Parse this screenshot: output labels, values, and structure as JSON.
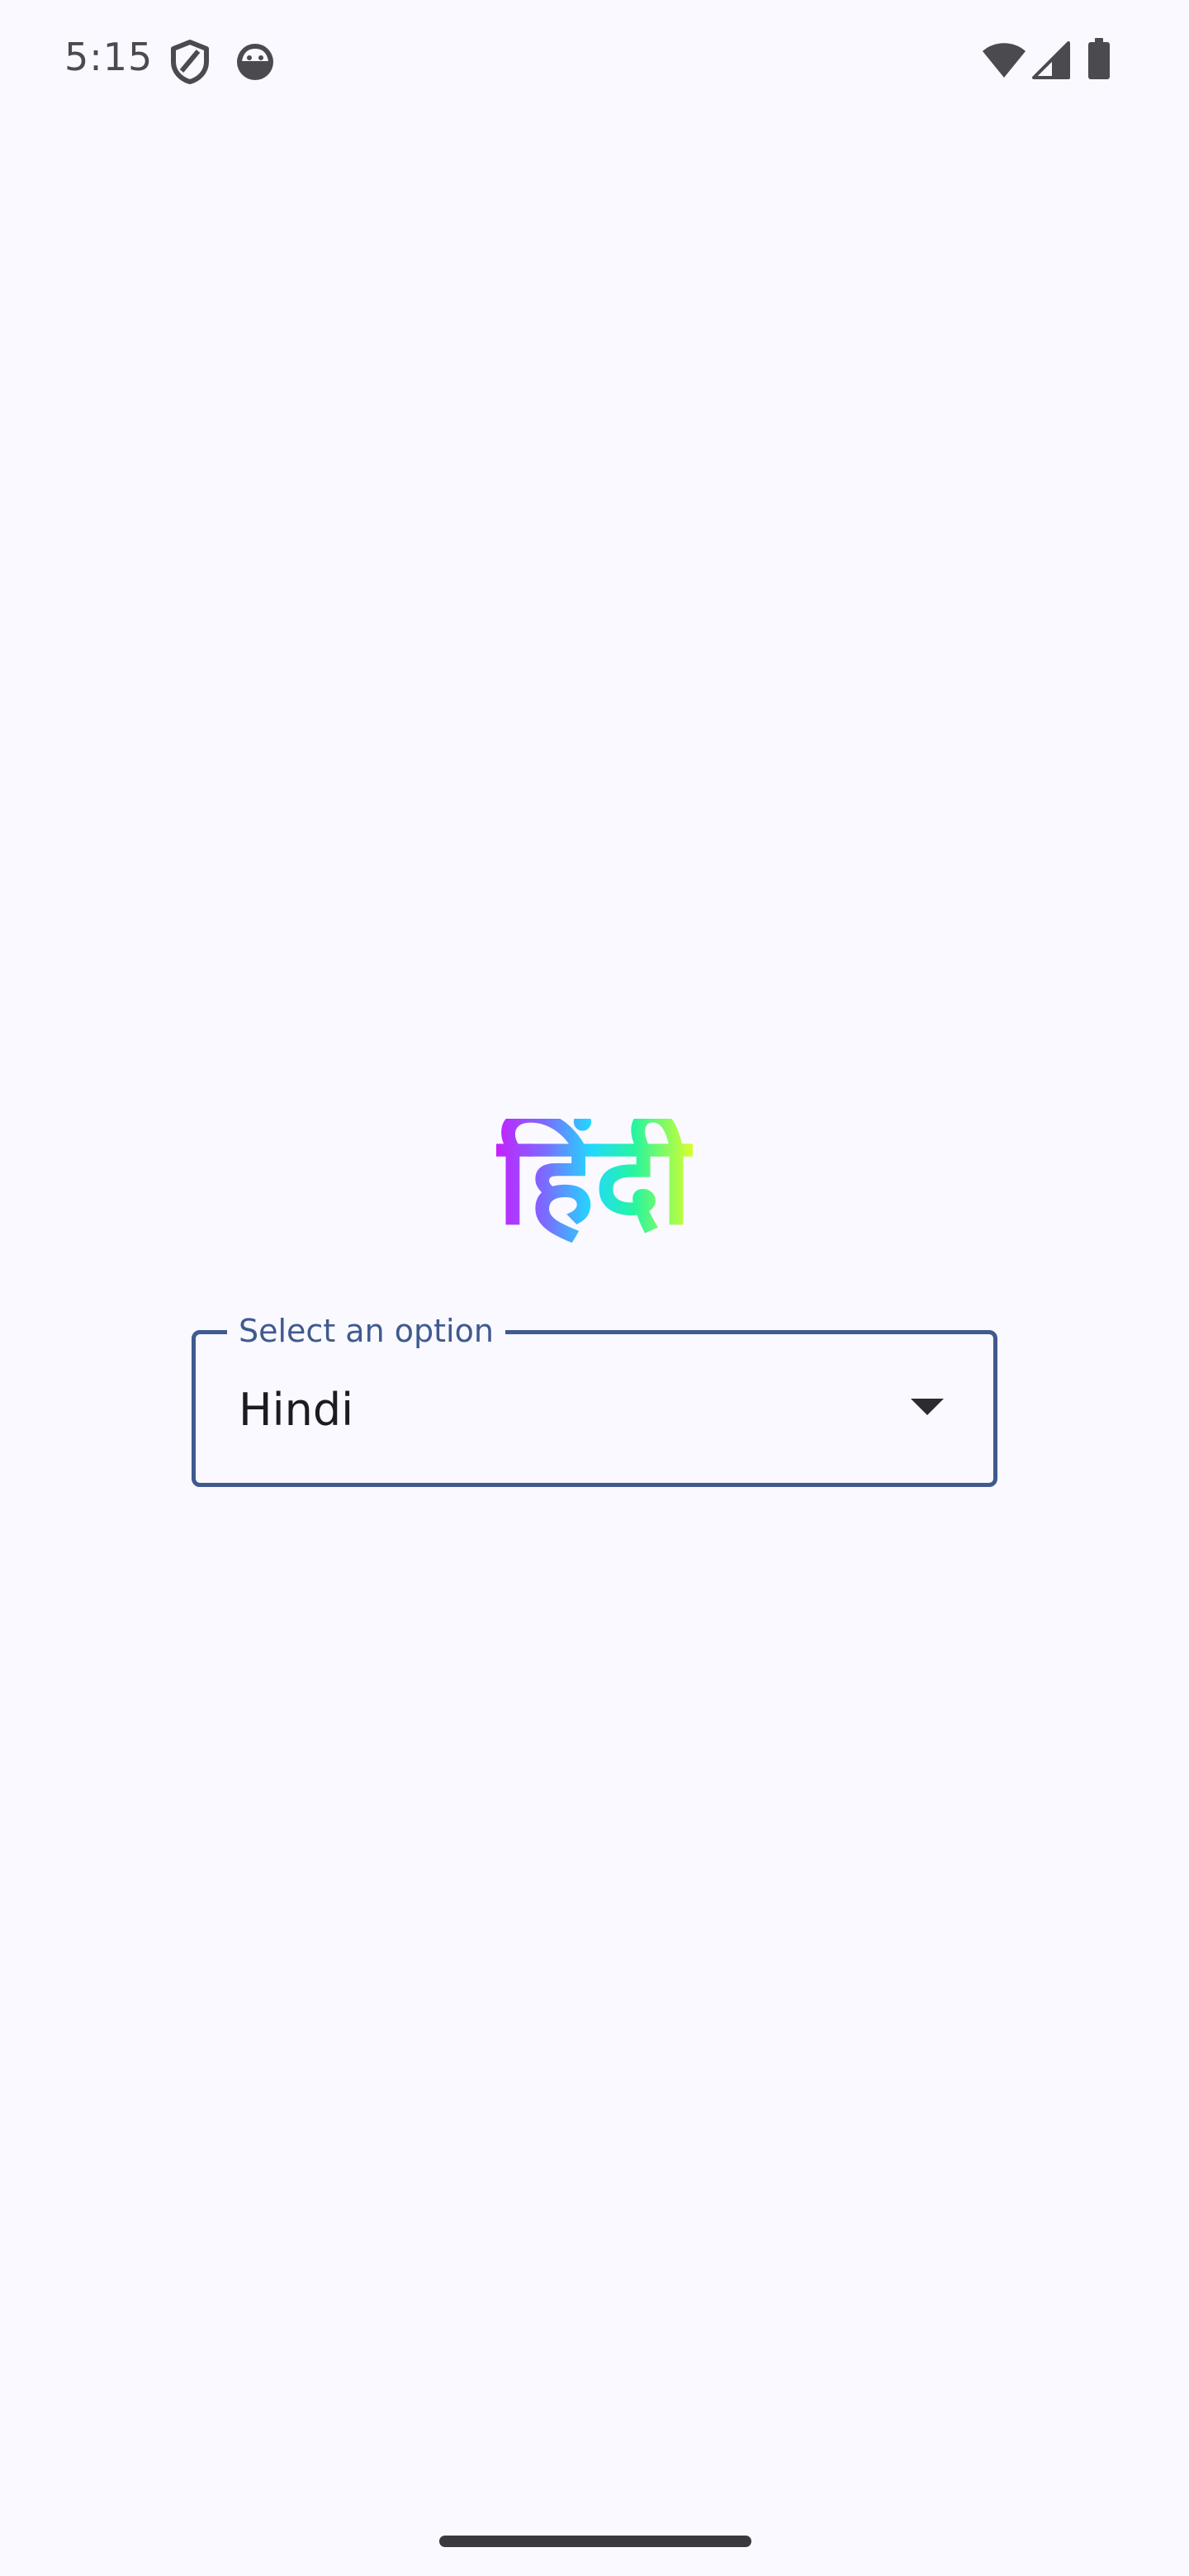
{
  "status_bar": {
    "time": "5:15",
    "icons": [
      "shield-icon",
      "android-face-icon",
      "wifi-icon",
      "cellular-signal-icon",
      "battery-icon"
    ]
  },
  "main": {
    "title": "हिंदी",
    "dropdown": {
      "label": "Select an option",
      "value": "Hindi",
      "icon": "chevron-down-icon"
    }
  },
  "colors": {
    "background": "#f9f9ff",
    "accent": "#3f5a8e",
    "title_gradient": [
      "#c520ff",
      "#7a6cff",
      "#22d8ff",
      "#26f5a0",
      "#d8ff2c"
    ]
  }
}
